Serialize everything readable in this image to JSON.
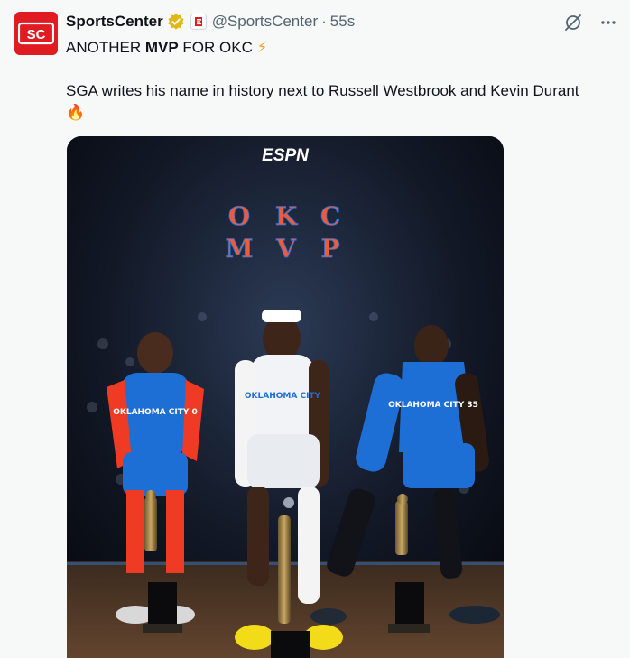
{
  "tweet": {
    "author_name": "SportsCenter",
    "handle": "@SportsCenter",
    "separator": "·",
    "time": "55s",
    "text_line1_pre": "ANOTHER ",
    "text_line1_bold": "MVP",
    "text_line1_post": " FOR OKC ",
    "text_line1_emoji": "⚡",
    "text_line2": "SGA writes his name in history next to Russell Westbrook and Kevin Durant",
    "text_line3_emoji": "🔥",
    "verified_icon": "gold-check-badge-icon",
    "affiliation_icon": "espn-affiliate-badge-icon"
  },
  "media": {
    "logo_text": "ESPN",
    "row1": [
      "O",
      "K",
      "C"
    ],
    "row2": [
      "M",
      "V",
      "P"
    ],
    "jersey_left": "OKLAHOMA CITY 0",
    "jersey_center": "OKLAHOMA CITY",
    "jersey_right": "OKLAHOMA CITY 35"
  },
  "colors": {
    "brand_red": "#e11b22",
    "okc_blue": "#1d6fd6",
    "okc_orange": "#ef3b24",
    "verified_gold": "#e2b719",
    "text_secondary": "#536471"
  }
}
